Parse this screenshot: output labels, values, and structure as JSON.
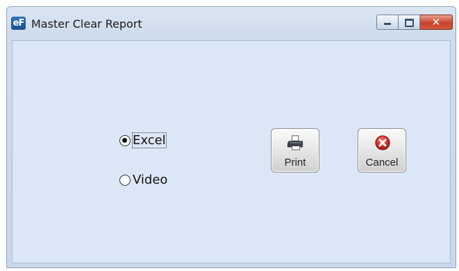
{
  "window": {
    "app_icon_text": "eF",
    "title": "Master Clear Report"
  },
  "options": [
    {
      "label": "Excel",
      "selected": true
    },
    {
      "label": "Video",
      "selected": false
    }
  ],
  "buttons": {
    "print_label": "Print",
    "cancel_label": "Cancel"
  },
  "icons": {
    "app": "ef-logo-icon",
    "print": "printer-icon",
    "cancel": "red-x-circle-icon"
  },
  "colors": {
    "client_bg": "#dbe7f6",
    "close_button": "#c7432a",
    "cancel_icon": "#d9332b"
  }
}
